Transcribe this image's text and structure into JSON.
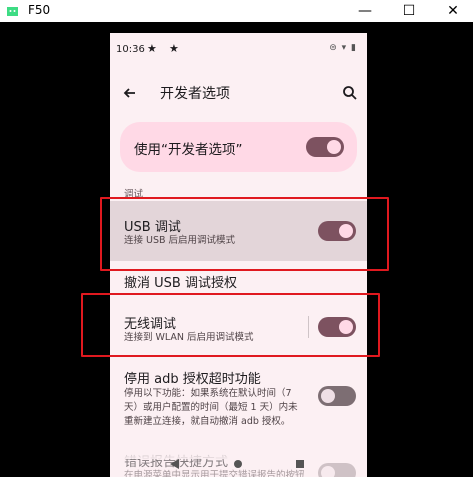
{
  "window": {
    "title": "F50",
    "minimize": "—",
    "maximize": "☐",
    "close": "✕"
  },
  "status_bar": {
    "time": "10:36",
    "icons": "⊜ ▾ ▮"
  },
  "app_bar": {
    "title": "开发者选项"
  },
  "master_toggle": {
    "label": "使用“开发者选项”",
    "on": true
  },
  "section_label": "调试",
  "settings": [
    {
      "title": "USB 调试",
      "subtitle": "连接 USB 后启用调试模式",
      "toggle": "on"
    },
    {
      "title": "撤消 USB 调试授权"
    },
    {
      "title": "无线调试",
      "subtitle": "连接到 WLAN 后启用调试模式",
      "toggle": "on"
    },
    {
      "title": "停用 adb 授权超时功能",
      "subtitle_lines": [
        "停用以下功能：如果系统在默认时间（7",
        "天）或用户配置的时间（最短 1 天）内未",
        "重新建立连接，就自动撤消 adb 授权。"
      ],
      "toggle": "off"
    },
    {
      "title": "错误报告快捷方式",
      "subtitle": "在电源菜单中显示用于提交错误报告的按钮",
      "toggle": "off"
    }
  ],
  "colors": {
    "toggle_on": "#7d5260",
    "toggle_off": "#7d6e73",
    "highlight_box": "#e0191f",
    "master_bg": "#ffd9e6"
  }
}
